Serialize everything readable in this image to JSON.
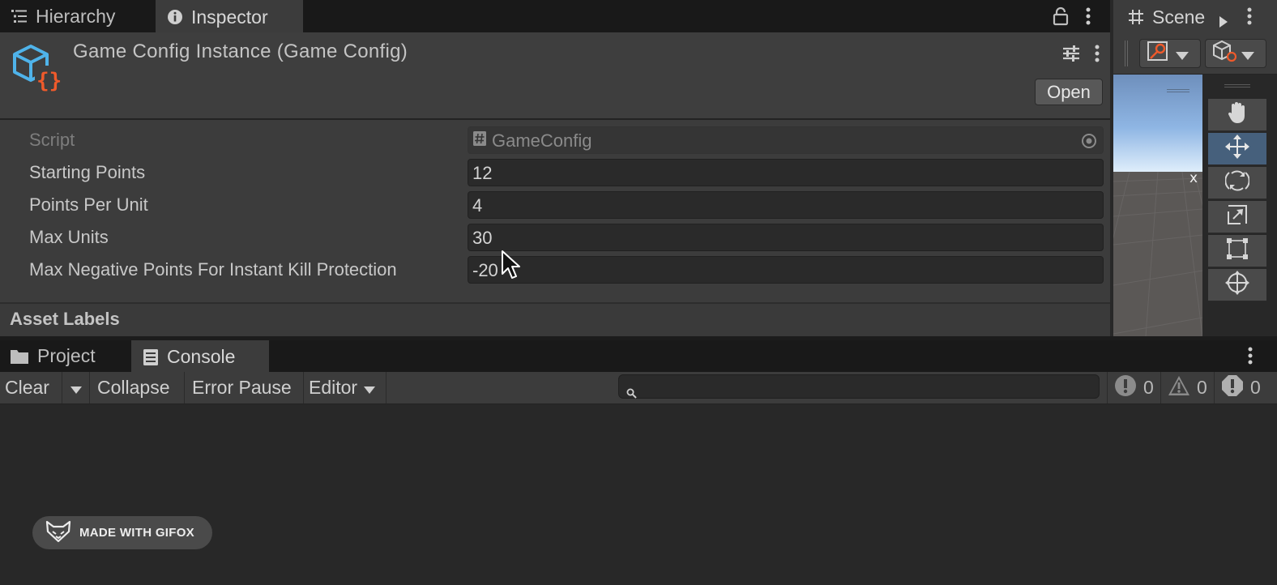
{
  "inspector": {
    "tabs": [
      {
        "label": "Hierarchy",
        "icon": "list-icon"
      },
      {
        "label": "Inspector",
        "icon": "info-icon"
      }
    ],
    "title": "Game Config Instance (Game Config)",
    "open_label": "Open",
    "script_field": {
      "label": "Script",
      "value": "GameConfig"
    },
    "properties": [
      {
        "label": "Starting Points",
        "value": "12"
      },
      {
        "label": "Points Per Unit",
        "value": "4"
      },
      {
        "label": "Max Units",
        "value": "30"
      },
      {
        "label": "Max Negative Points For Instant Kill Protection",
        "value": "-20"
      }
    ],
    "asset_labels": "Asset Labels"
  },
  "scene": {
    "tab_label": "Scene",
    "axis_label": "x",
    "tools": [
      "hand-tool",
      "move-tool",
      "rotate-tool",
      "scale-tool",
      "rect-tool",
      "transform-tool"
    ],
    "active_tool": "move-tool"
  },
  "console": {
    "tabs": [
      {
        "label": "Project",
        "icon": "folder-icon"
      },
      {
        "label": "Console",
        "icon": "console-icon"
      }
    ],
    "toolbar": {
      "clear": "Clear",
      "collapse": "Collapse",
      "error_pause": "Error Pause",
      "editor": "Editor"
    },
    "search_placeholder": "",
    "counts": {
      "info": "0",
      "warning": "0",
      "error": "0"
    }
  },
  "watermark": {
    "text": "MADE WITH GIFOX"
  },
  "colors": {
    "panel": "#3c3c3c",
    "tab_strip": "#191919",
    "field": "#2a2a2a",
    "accent_active_tool": "#46607c",
    "asset_icon_blue": "#4fb3ea",
    "asset_icon_orange": "#ef5a2b"
  }
}
